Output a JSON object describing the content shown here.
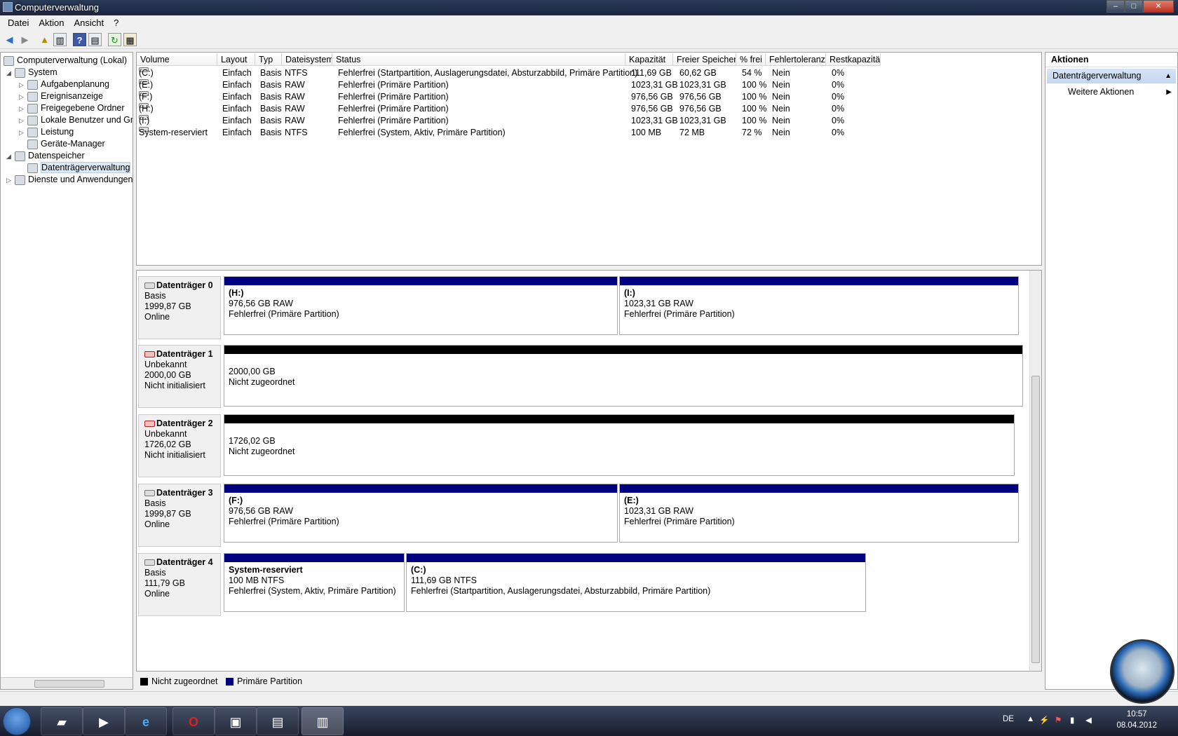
{
  "window": {
    "title": "Computerverwaltung",
    "controls": [
      "–",
      "□",
      "✕"
    ]
  },
  "menu": [
    "Datei",
    "Aktion",
    "Ansicht",
    "?"
  ],
  "tree": {
    "root": "Computerverwaltung (Lokal)",
    "system": "System",
    "items": [
      "Aufgabenplanung",
      "Ereignisanzeige",
      "Freigegebene Ordner",
      "Lokale Benutzer und Gruppen",
      "Leistung",
      "Geräte-Manager"
    ],
    "storage": "Datenspeicher",
    "storage_item": "Datenträgerverwaltung",
    "services": "Dienste und Anwendungen"
  },
  "volumes": {
    "columns": [
      "Volume",
      "Layout",
      "Typ",
      "Dateisystem",
      "Status",
      "Kapazität",
      "Freier Speicher",
      "% frei",
      "Fehlertoleranz",
      "Restkapazität"
    ],
    "rows": [
      [
        "(C:)",
        "Einfach",
        "Basis",
        "NTFS",
        "Fehlerfrei (Startpartition, Auslagerungsdatei, Absturzabbild, Primäre Partition)",
        "111,69 GB",
        "60,62 GB",
        "54 %",
        "Nein",
        "0%"
      ],
      [
        "(E:)",
        "Einfach",
        "Basis",
        "RAW",
        "Fehlerfrei (Primäre Partition)",
        "1023,31 GB",
        "1023,31 GB",
        "100 %",
        "Nein",
        "0%"
      ],
      [
        "(F:)",
        "Einfach",
        "Basis",
        "RAW",
        "Fehlerfrei (Primäre Partition)",
        "976,56 GB",
        "976,56 GB",
        "100 %",
        "Nein",
        "0%"
      ],
      [
        "(H:)",
        "Einfach",
        "Basis",
        "RAW",
        "Fehlerfrei (Primäre Partition)",
        "976,56 GB",
        "976,56 GB",
        "100 %",
        "Nein",
        "0%"
      ],
      [
        "(I:)",
        "Einfach",
        "Basis",
        "RAW",
        "Fehlerfrei (Primäre Partition)",
        "1023,31 GB",
        "1023,31 GB",
        "100 %",
        "Nein",
        "0%"
      ],
      [
        "System-reserviert",
        "Einfach",
        "Basis",
        "NTFS",
        "Fehlerfrei (System, Aktiv, Primäre Partition)",
        "100 MB",
        "72 MB",
        "72 %",
        "Nein",
        "0%"
      ]
    ]
  },
  "disks": [
    {
      "name": "Datenträger 0",
      "type": "Basis",
      "size": "1999,87 GB",
      "state": "Online",
      "parts": [
        {
          "name": "(H:)",
          "size": "976,56 GB RAW",
          "status": "Fehlerfrei (Primäre Partition)"
        },
        {
          "name": "(I:)",
          "size": "1023,31 GB RAW",
          "status": "Fehlerfrei (Primäre Partition)"
        }
      ]
    },
    {
      "name": "Datenträger 1",
      "type": "Unbekannt",
      "size": "2000,00 GB",
      "state": "Nicht initialisiert",
      "parts": [
        {
          "size": "2000,00 GB",
          "status": "Nicht zugeordnet"
        }
      ]
    },
    {
      "name": "Datenträger 2",
      "type": "Unbekannt",
      "size": "1726,02 GB",
      "state": "Nicht initialisiert",
      "parts": [
        {
          "size": "1726,02 GB",
          "status": "Nicht zugeordnet"
        }
      ]
    },
    {
      "name": "Datenträger 3",
      "type": "Basis",
      "size": "1999,87 GB",
      "state": "Online",
      "parts": [
        {
          "name": "(F:)",
          "size": "976,56 GB RAW",
          "status": "Fehlerfrei (Primäre Partition)"
        },
        {
          "name": "(E:)",
          "size": "1023,31 GB RAW",
          "status": "Fehlerfrei (Primäre Partition)"
        }
      ]
    },
    {
      "name": "Datenträger 4",
      "type": "Basis",
      "size": "111,79 GB",
      "state": "Online",
      "parts": [
        {
          "name": "System-reserviert",
          "size": "100 MB NTFS",
          "status": "Fehlerfrei (System, Aktiv, Primäre Partition)"
        },
        {
          "name": "(C:)",
          "size": "111,69 GB NTFS",
          "status": "Fehlerfrei (Startpartition, Auslagerungsdatei, Absturzabbild, Primäre Partition)"
        }
      ]
    }
  ],
  "legend": {
    "unallocated": "Nicht zugeordnet",
    "primary": "Primäre Partition",
    "unallocated_color": "#000000",
    "primary_color": "#000080"
  },
  "actions": {
    "header": "Aktionen",
    "section": "Datenträgerverwaltung",
    "more": "Weitere Aktionen"
  },
  "taskbar": {
    "lang": "DE",
    "time": "10:57",
    "date": "08.04.2012"
  }
}
